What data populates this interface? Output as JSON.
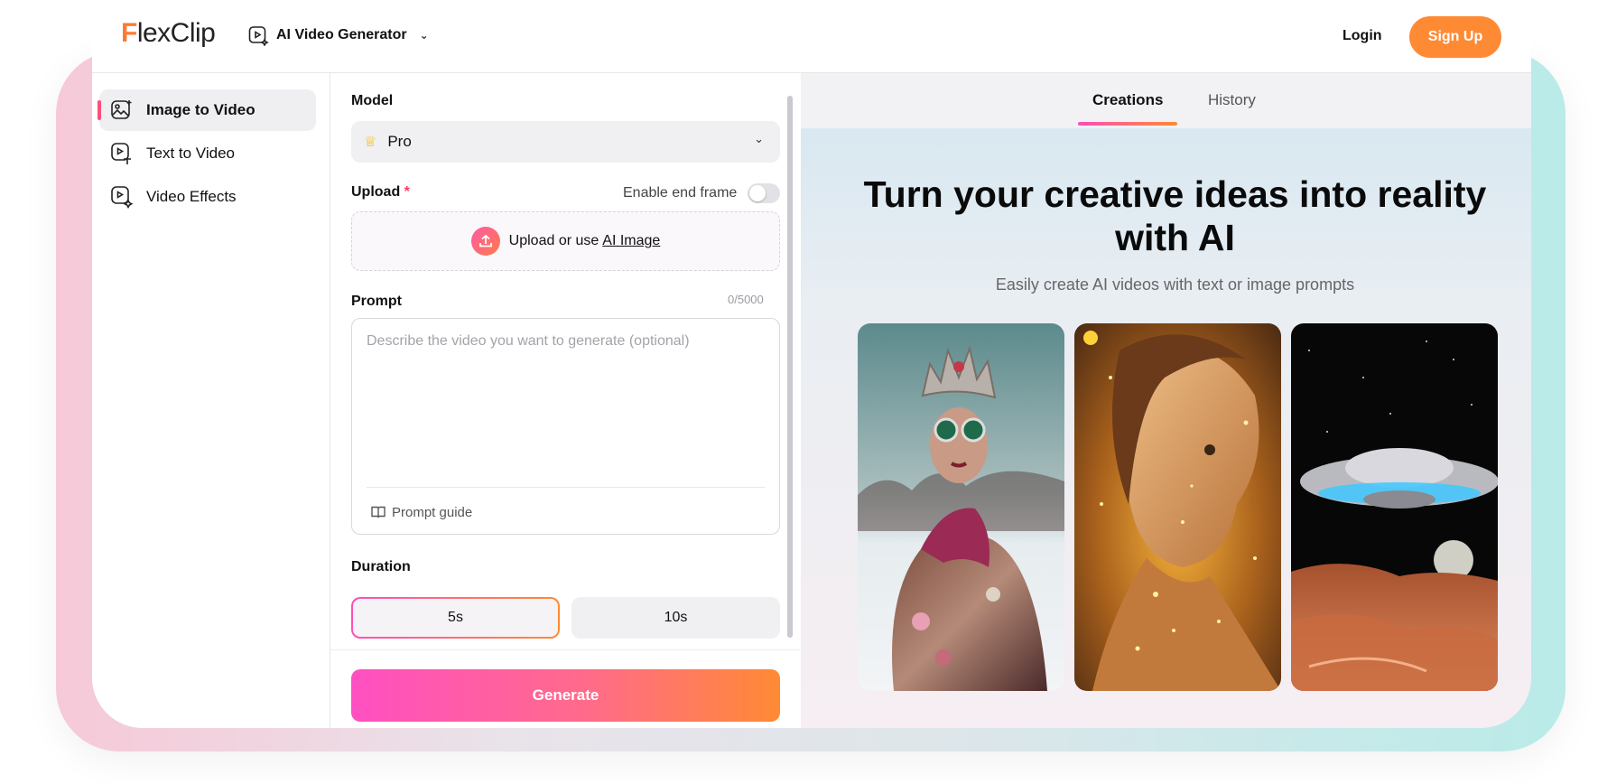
{
  "brand": {
    "logo_text": "FlexClip",
    "accent": "#ff8a34"
  },
  "header": {
    "product_label": "AI Video Generator",
    "login_label": "Login",
    "signup_label": "Sign Up"
  },
  "sidebar": {
    "items": [
      {
        "label": "Image to Video",
        "icon": "image-to-video-icon",
        "active": true
      },
      {
        "label": "Text to Video",
        "icon": "text-to-video-icon",
        "active": false
      },
      {
        "label": "Video Effects",
        "icon": "video-effects-icon",
        "active": false
      }
    ]
  },
  "form": {
    "model_label": "Model",
    "model_value": "Pro",
    "upload_label": "Upload",
    "required_mark": "*",
    "enable_end_frame_label": "Enable end frame",
    "upload_text": "Upload or use",
    "upload_link": "AI Image",
    "prompt_label": "Prompt",
    "prompt_counter": "0/5000",
    "prompt_placeholder": "Describe the video you want to generate (optional)",
    "prompt_guide_label": "Prompt guide",
    "duration_label": "Duration",
    "durations": [
      "5s",
      "10s"
    ],
    "duration_selected": "5s",
    "generate_label": "Generate"
  },
  "right_panel": {
    "tabs": [
      "Creations",
      "History"
    ],
    "active_tab": "Creations",
    "hero_title": "Turn your creative ideas into reality with AI",
    "hero_subtitle": "Easily create AI videos with text or image prompts",
    "samples": [
      {
        "subject": "woman-with-jeweled-crown"
      },
      {
        "subject": "glowing-woman-portrait"
      },
      {
        "subject": "ufo-over-red-canyon"
      }
    ]
  }
}
